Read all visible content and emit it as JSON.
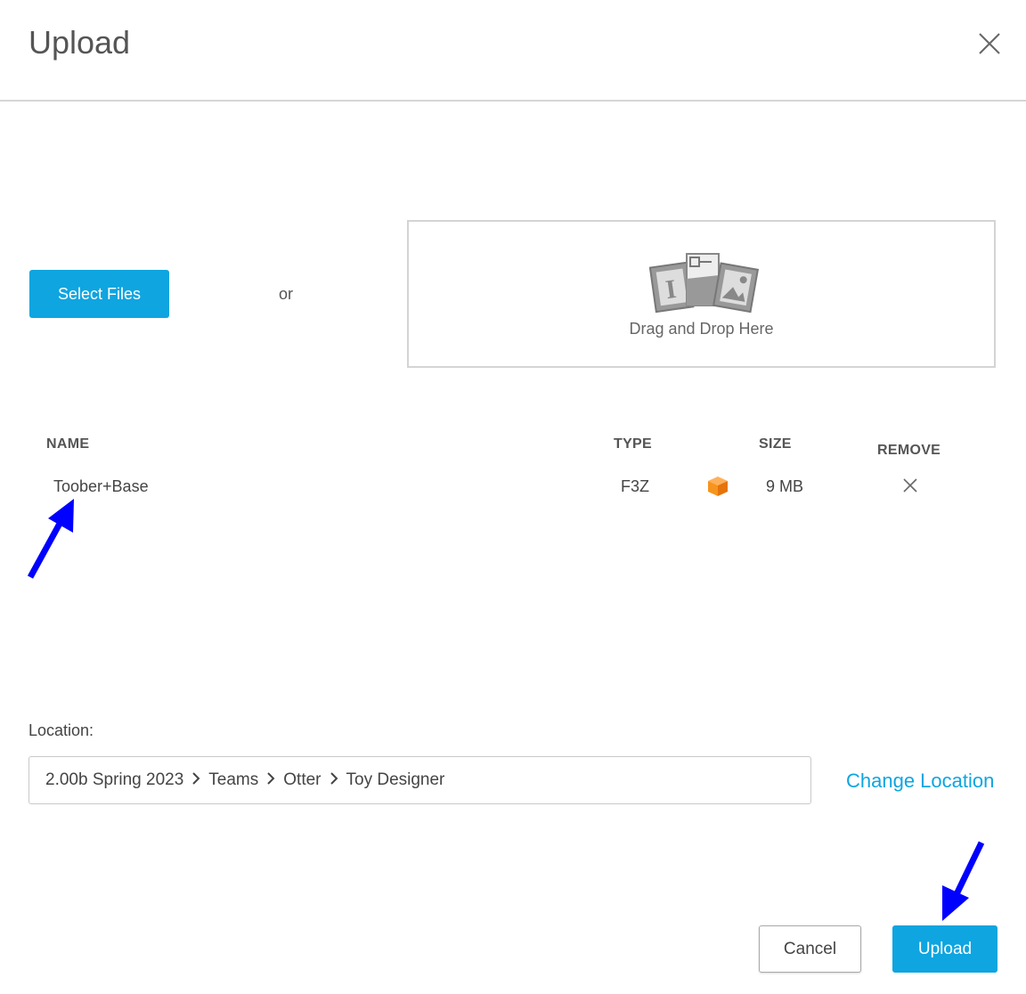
{
  "dialog": {
    "title": "Upload",
    "close_icon": "close-icon"
  },
  "picker": {
    "select_files_label": "Select Files",
    "or_label": "or",
    "dropzone_label": "Drag and Drop Here",
    "dropzone_icon": "files-illustration-icon"
  },
  "table": {
    "columns": {
      "name": "NAME",
      "type": "TYPE",
      "size": "SIZE",
      "remove": "REMOVE"
    },
    "rows": [
      {
        "name": "Toober+Base",
        "type": "F3Z",
        "type_icon": "orange-cube-icon",
        "size": "9 MB",
        "remove_icon": "close-icon"
      }
    ]
  },
  "location": {
    "label": "Location:",
    "path": [
      "2.00b Spring 2023",
      "Teams",
      "Otter",
      "Toy Designer"
    ],
    "change_label": "Change Location"
  },
  "footer": {
    "cancel_label": "Cancel",
    "upload_label": "Upload"
  },
  "annotations": {
    "arrow_color": "#0000ff"
  },
  "colors": {
    "accent": "#0ea5e0",
    "cube": "#f7941d"
  }
}
